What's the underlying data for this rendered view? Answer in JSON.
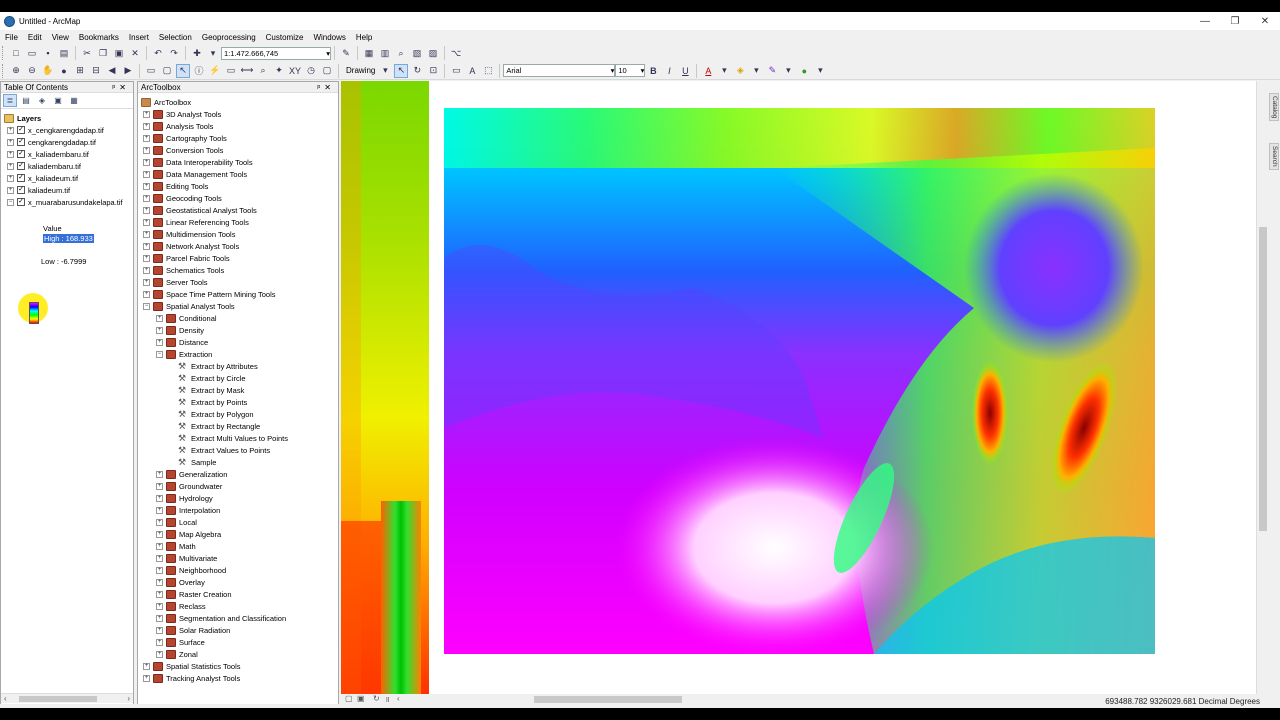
{
  "window": {
    "title": "Untitled - ArcMap",
    "controls": [
      "—",
      "❐",
      "✕"
    ]
  },
  "menu": [
    "File",
    "Edit",
    "View",
    "Bookmarks",
    "Insert",
    "Selection",
    "Geoprocessing",
    "Customize",
    "Windows",
    "Help"
  ],
  "toolbar": {
    "scale": "1:1.472.666,745",
    "drawing_label": "Drawing",
    "font": "Arial",
    "font_size": "10",
    "bold": "B",
    "italic": "I",
    "underline": "U",
    "font_color_letter": "A"
  },
  "toc": {
    "title": "Table Of Contents",
    "root": "Layers",
    "layers": [
      {
        "name": "x_cengkarengdadap.tif",
        "checked": true
      },
      {
        "name": "cengkarengdadap.tif",
        "checked": true
      },
      {
        "name": "x_kaliadembaru.tif",
        "checked": true
      },
      {
        "name": "kaliadembaru.tif",
        "checked": true
      },
      {
        "name": "x_kaliadeum.tif",
        "checked": true
      },
      {
        "name": "kaliadeum.tif",
        "checked": true
      },
      {
        "name": "x_muarabarusundakelapa.tif",
        "checked": true
      }
    ],
    "legend": {
      "field": "Value",
      "high": "High : 168.933",
      "low": "Low : -6.7999"
    }
  },
  "toolbox": {
    "title": "ArcToolbox",
    "root": "ArcToolbox",
    "items": [
      {
        "label": "3D Analyst Tools",
        "level": 1,
        "type": "toolbox",
        "exp": "+"
      },
      {
        "label": "Analysis Tools",
        "level": 1,
        "type": "toolbox",
        "exp": "+"
      },
      {
        "label": "Cartography Tools",
        "level": 1,
        "type": "toolbox",
        "exp": "+"
      },
      {
        "label": "Conversion Tools",
        "level": 1,
        "type": "toolbox",
        "exp": "+"
      },
      {
        "label": "Data Interoperability Tools",
        "level": 1,
        "type": "toolbox",
        "exp": "+"
      },
      {
        "label": "Data Management Tools",
        "level": 1,
        "type": "toolbox",
        "exp": "+"
      },
      {
        "label": "Editing Tools",
        "level": 1,
        "type": "toolbox",
        "exp": "+"
      },
      {
        "label": "Geocoding Tools",
        "level": 1,
        "type": "toolbox",
        "exp": "+"
      },
      {
        "label": "Geostatistical Analyst Tools",
        "level": 1,
        "type": "toolbox",
        "exp": "+"
      },
      {
        "label": "Linear Referencing Tools",
        "level": 1,
        "type": "toolbox",
        "exp": "+"
      },
      {
        "label": "Multidimension Tools",
        "level": 1,
        "type": "toolbox",
        "exp": "+"
      },
      {
        "label": "Network Analyst Tools",
        "level": 1,
        "type": "toolbox",
        "exp": "+"
      },
      {
        "label": "Parcel Fabric Tools",
        "level": 1,
        "type": "toolbox",
        "exp": "+"
      },
      {
        "label": "Schematics Tools",
        "level": 1,
        "type": "toolbox",
        "exp": "+"
      },
      {
        "label": "Server Tools",
        "level": 1,
        "type": "toolbox",
        "exp": "+"
      },
      {
        "label": "Space Time Pattern Mining Tools",
        "level": 1,
        "type": "toolbox",
        "exp": "+"
      },
      {
        "label": "Spatial Analyst Tools",
        "level": 1,
        "type": "toolbox",
        "exp": "−"
      },
      {
        "label": "Conditional",
        "level": 2,
        "type": "toolset",
        "exp": "+"
      },
      {
        "label": "Density",
        "level": 2,
        "type": "toolset",
        "exp": "+"
      },
      {
        "label": "Distance",
        "level": 2,
        "type": "toolset",
        "exp": "+"
      },
      {
        "label": "Extraction",
        "level": 2,
        "type": "toolset",
        "exp": "−"
      },
      {
        "label": "Extract by Attributes",
        "level": 3,
        "type": "tool"
      },
      {
        "label": "Extract by Circle",
        "level": 3,
        "type": "tool"
      },
      {
        "label": "Extract by Mask",
        "level": 3,
        "type": "tool"
      },
      {
        "label": "Extract by Points",
        "level": 3,
        "type": "tool"
      },
      {
        "label": "Extract by Polygon",
        "level": 3,
        "type": "tool"
      },
      {
        "label": "Extract by Rectangle",
        "level": 3,
        "type": "tool"
      },
      {
        "label": "Extract Multi Values to Points",
        "level": 3,
        "type": "tool"
      },
      {
        "label": "Extract Values to Points",
        "level": 3,
        "type": "tool"
      },
      {
        "label": "Sample",
        "level": 3,
        "type": "tool"
      },
      {
        "label": "Generalization",
        "level": 2,
        "type": "toolset",
        "exp": "+"
      },
      {
        "label": "Groundwater",
        "level": 2,
        "type": "toolset",
        "exp": "+"
      },
      {
        "label": "Hydrology",
        "level": 2,
        "type": "toolset",
        "exp": "+"
      },
      {
        "label": "Interpolation",
        "level": 2,
        "type": "toolset",
        "exp": "+"
      },
      {
        "label": "Local",
        "level": 2,
        "type": "toolset",
        "exp": "+"
      },
      {
        "label": "Map Algebra",
        "level": 2,
        "type": "toolset",
        "exp": "+"
      },
      {
        "label": "Math",
        "level": 2,
        "type": "toolset",
        "exp": "+"
      },
      {
        "label": "Multivariate",
        "level": 2,
        "type": "toolset",
        "exp": "+"
      },
      {
        "label": "Neighborhood",
        "level": 2,
        "type": "toolset",
        "exp": "+"
      },
      {
        "label": "Overlay",
        "level": 2,
        "type": "toolset",
        "exp": "+"
      },
      {
        "label": "Raster Creation",
        "level": 2,
        "type": "toolset",
        "exp": "+"
      },
      {
        "label": "Reclass",
        "level": 2,
        "type": "toolset",
        "exp": "+"
      },
      {
        "label": "Segmentation and Classification",
        "level": 2,
        "type": "toolset",
        "exp": "+"
      },
      {
        "label": "Solar Radiation",
        "level": 2,
        "type": "toolset",
        "exp": "+"
      },
      {
        "label": "Surface",
        "level": 2,
        "type": "toolset",
        "exp": "+"
      },
      {
        "label": "Zonal",
        "level": 2,
        "type": "toolset",
        "exp": "+"
      },
      {
        "label": "Spatial Statistics Tools",
        "level": 1,
        "type": "toolbox",
        "exp": "+"
      },
      {
        "label": "Tracking Analyst Tools",
        "level": 1,
        "type": "toolbox",
        "exp": "+"
      }
    ]
  },
  "side_tabs": [
    "Catalog",
    "Search"
  ],
  "status": {
    "coordinates": "693488.782  9326029.681 Decimal Degrees"
  },
  "colors": {
    "selection": "#3470d8",
    "toolbox_icon": "#b5452f",
    "cursor_halo": "#ffeb00"
  }
}
